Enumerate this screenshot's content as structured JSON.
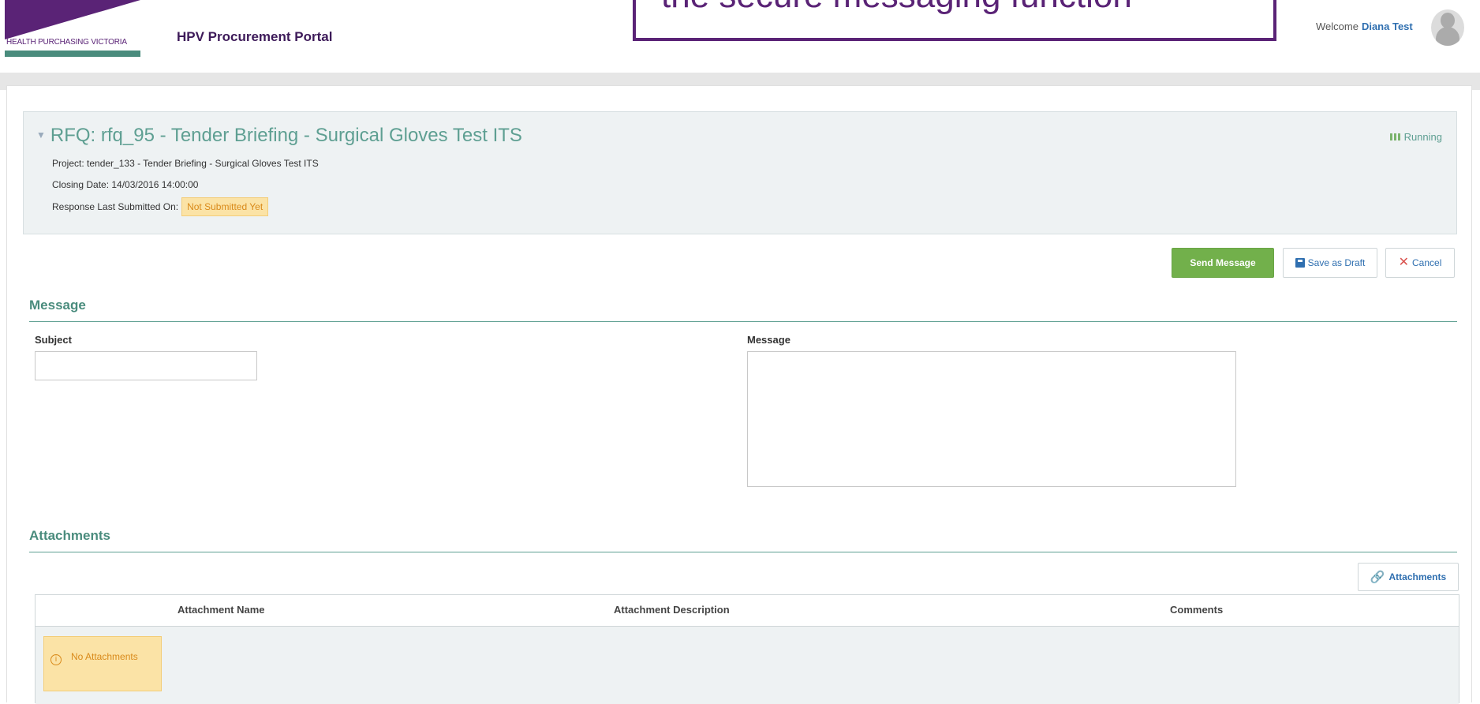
{
  "header": {
    "logo_text": "HEALTH PURCHASING VICTORIA",
    "portal_title": "HPV Procurement Portal",
    "callout_text": "the secure messaging function",
    "welcome_label": "Welcome",
    "user_name": "Diana Test"
  },
  "rfq": {
    "title": "RFQ: rfq_95 - Tender Briefing - Surgical Gloves Test ITS",
    "status": "Running",
    "project": "Project: tender_133 - Tender Briefing - Surgical Gloves Test ITS",
    "closing_date": "Closing Date: 14/03/2016 14:00:00",
    "last_submitted_label": "Response Last Submitted On:",
    "last_submitted_value": "Not Submitted Yet"
  },
  "actions": {
    "send": "Send Message",
    "draft": "Save as Draft",
    "cancel": "Cancel"
  },
  "message_section": {
    "title": "Message",
    "subject_label": "Subject",
    "subject_value": "",
    "message_label": "Message",
    "message_value": ""
  },
  "attachments": {
    "title": "Attachments",
    "button": "Attachments",
    "columns": [
      "Attachment Name",
      "Attachment Description",
      "Comments"
    ],
    "empty_text": "No Attachments"
  },
  "colors": {
    "brand_purple": "#5a2376",
    "teal": "#4a8c7d",
    "send_green": "#72b04b",
    "warn_bg": "#fbe3a6"
  }
}
